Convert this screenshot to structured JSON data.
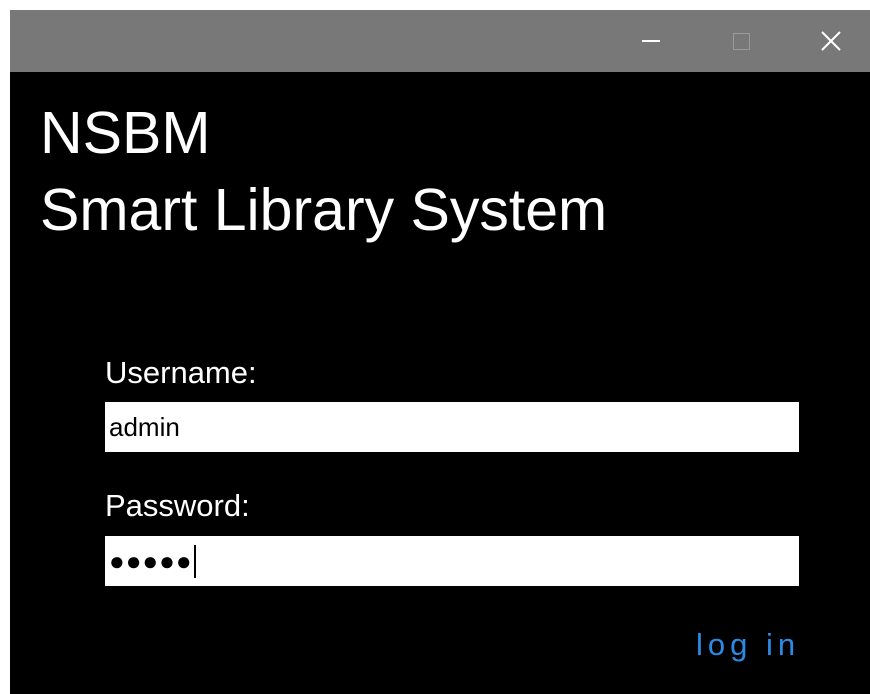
{
  "window": {
    "controls": {
      "minimize_icon": "minimize-icon",
      "maximize_icon": "maximize-icon",
      "close_icon": "close-icon"
    }
  },
  "header": {
    "title_line_1": "NSBM",
    "title_line_2": "Smart Library System"
  },
  "form": {
    "username_label": "Username:",
    "username_value": "admin",
    "password_label": "Password:",
    "password_mask": "●●●●●",
    "login_label": "log in"
  },
  "colors": {
    "background": "#000000",
    "titlebar": "#787878",
    "text": "#ffffff",
    "link": "#2a8be6",
    "field_bg": "#ffffff"
  }
}
